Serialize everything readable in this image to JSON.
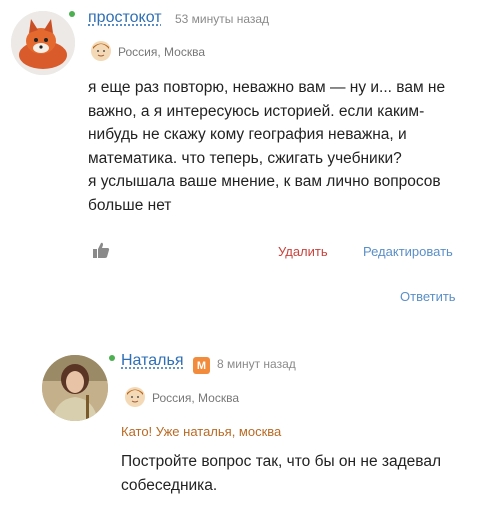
{
  "comments": [
    {
      "username": "простокот",
      "time": "53 минуты назад",
      "location": "Россия, Москва",
      "text": "я еще раз повторю, неважно вам — ну и... вам не\nважно, а я интересуюсь историей. если каким-\nнибудь не скажу кому география неважна, и\nматематика. что теперь, сжигать учебники?\nя услышала ваше мнение, к вам лично вопросов\nбольше нет",
      "actions": {
        "delete": "Удалить",
        "edit": "Редактировать",
        "reply": "Ответить"
      }
    },
    {
      "username": "Наталья",
      "badge": "М",
      "time": "8 минут назад",
      "location": "Россия, Москва",
      "quote": "Като! Уже наталья, москва",
      "text": "Постройте вопрос так, что бы он не задевал\nсобеседника."
    }
  ],
  "colors": {
    "link": "#2f6fb5",
    "delete": "#c9423c",
    "online": "#4caf50",
    "badge": "#f28b3c",
    "quote": "#b86a24"
  }
}
